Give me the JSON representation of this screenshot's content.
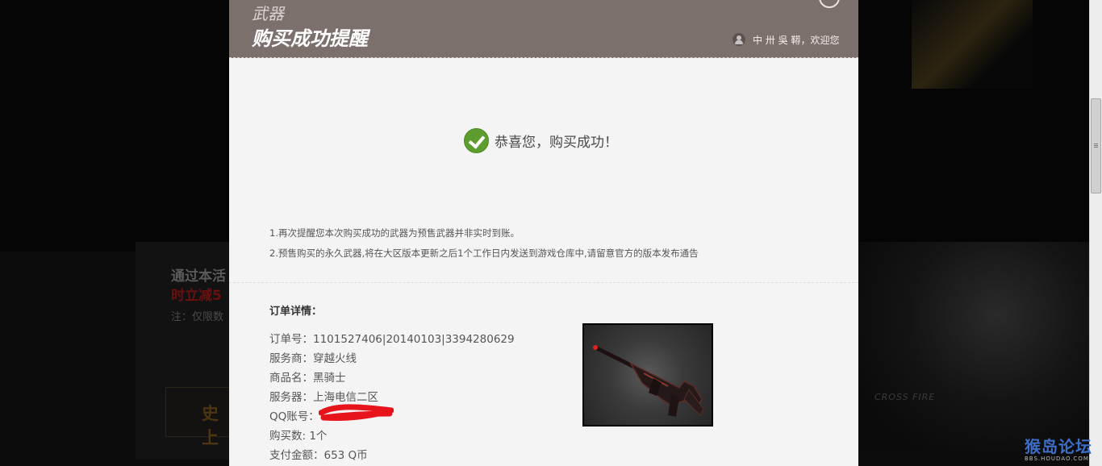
{
  "background": {
    "promo_line1": "通过本活",
    "promo_line2": "时立减5",
    "promo_line3": "注：仅限数",
    "badge_text": "史上",
    "brand_text": "CROSS FIRE"
  },
  "watermark": {
    "site": "猴岛论坛",
    "url": "BBS.HOUDAO.COM"
  },
  "modal": {
    "header": {
      "subtitle": "武器",
      "title": "购买成功提醒",
      "user_greeting": "中 卅 吳 鞯，欢迎您"
    },
    "success_message": "恭喜您，购买成功！",
    "notices": [
      "1.再次提醒您本次购买成功的武器为预售武器并非实时到账。",
      "2.预售购买的永久武器,将在大区版本更新之后1个工作日内发送到游戏仓库中,请留意官方的版本发布通告"
    ],
    "order": {
      "heading": "订单详情：",
      "rows": [
        "订单号：1101527406|20140103|3394280629",
        "服务商：穿越火线",
        "商品名：黑骑士",
        "服务器：上海电信二区",
        "QQ账号：",
        "购买数: 1个",
        "支付金额：653 Q币"
      ]
    },
    "colors": {
      "header_bg": "#7c706d",
      "success_green": "#5d9d2f",
      "redaction_red": "#e8141c"
    }
  }
}
